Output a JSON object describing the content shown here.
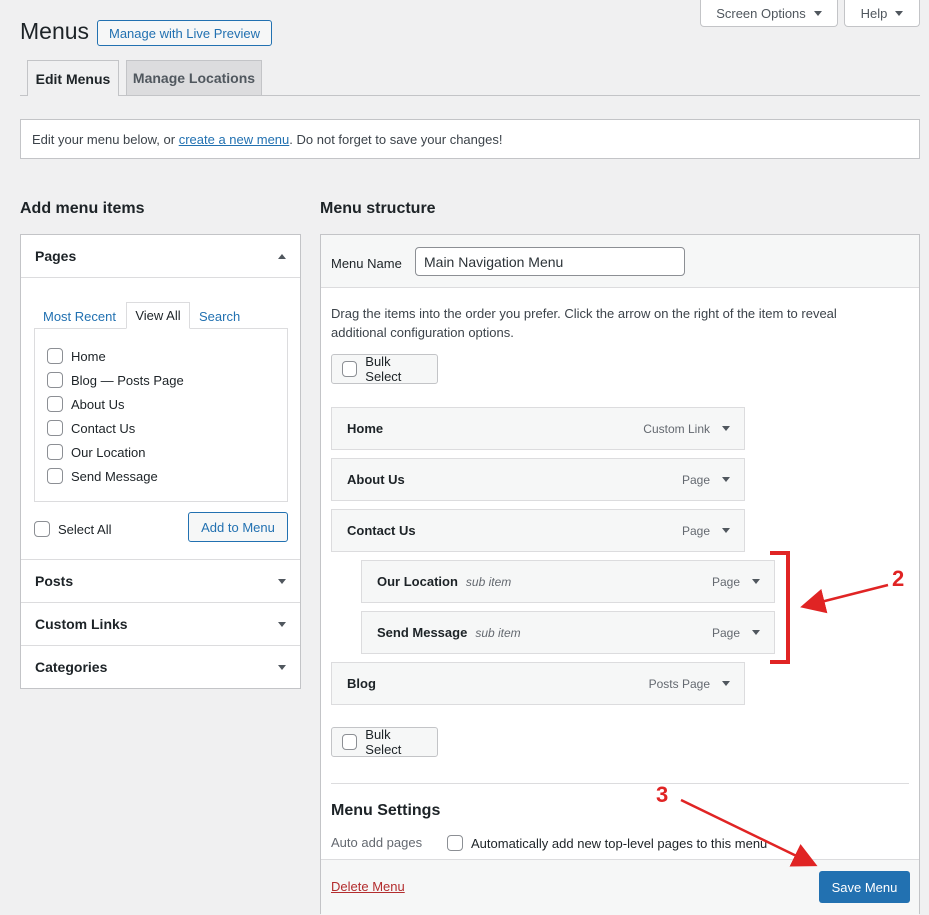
{
  "header": {
    "title": "Menus",
    "live_preview": "Manage with Live Preview",
    "screen_options": "Screen Options",
    "help": "Help"
  },
  "tabs": [
    {
      "label": "Edit Menus"
    },
    {
      "label": "Manage Locations"
    }
  ],
  "notice": {
    "prefix": "Edit your menu below, or ",
    "link": "create a new menu",
    "suffix": ". Do not forget to save your changes!"
  },
  "add_items": {
    "heading": "Add menu items",
    "pages": {
      "title": "Pages",
      "tabs": [
        "Most Recent",
        "View All",
        "Search"
      ],
      "items": [
        "Home",
        "Blog — Posts Page",
        "About Us",
        "Contact Us",
        "Our Location",
        "Send Message"
      ],
      "select_all": "Select All",
      "add_button": "Add to Menu"
    },
    "sections": [
      "Posts",
      "Custom Links",
      "Categories"
    ]
  },
  "structure": {
    "heading": "Menu structure",
    "name_label": "Menu Name",
    "name_value": "Main Navigation Menu",
    "instructions": "Drag the items into the order you prefer. Click the arrow on the right of the item to reveal additional configuration options.",
    "bulk_select": "Bulk Select",
    "items": [
      {
        "title": "Home",
        "sub": "",
        "type": "Custom Link"
      },
      {
        "title": "About Us",
        "sub": "",
        "type": "Page"
      },
      {
        "title": "Contact Us",
        "sub": "",
        "type": "Page"
      },
      {
        "title": "Our Location",
        "sub": "sub item",
        "type": "Page"
      },
      {
        "title": "Send Message",
        "sub": "sub item",
        "type": "Page"
      },
      {
        "title": "Blog",
        "sub": "",
        "type": "Posts Page"
      }
    ],
    "settings_heading": "Menu Settings",
    "auto_add_label": "Auto add pages",
    "auto_add_text": "Automatically add new top-level pages to this menu",
    "delete": "Delete Menu",
    "save": "Save Menu"
  },
  "annotations": {
    "bracket_label": "2",
    "save_label": "3",
    "color": "#e02424"
  }
}
